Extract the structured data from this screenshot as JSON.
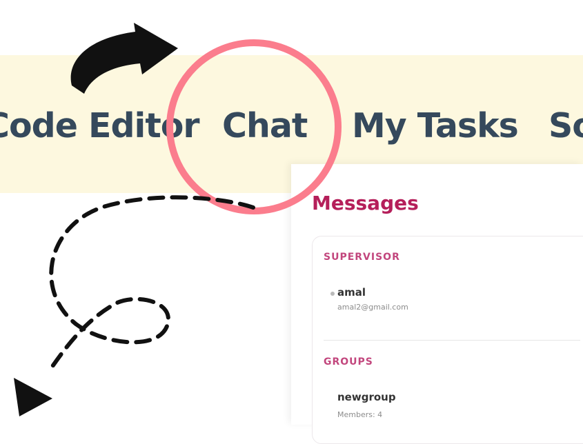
{
  "nav": {
    "items": [
      "Code Editor",
      "Chat",
      "My Tasks",
      "So"
    ]
  },
  "messages_panel": {
    "title": "Messages",
    "supervisor_section": {
      "heading": "SUPERVISOR",
      "name": "amal",
      "email": "amal2@gmail.com"
    },
    "groups_section": {
      "heading": "GROUPS",
      "group_name": "newgroup",
      "members": "Members: 4"
    }
  },
  "colors": {
    "nav_bg": "#fdf8df",
    "nav_text": "#35495c",
    "title_accent": "#b51f5a",
    "section_accent": "#c2467d",
    "highlight_ring": "#fb7d8d"
  },
  "annotations": {
    "curved_arrow_icon": "curved-arrow-right-icon",
    "highlight_circle": "highlight-circle",
    "dashed_arrow_icon": "dashed-loop-arrow-icon"
  }
}
